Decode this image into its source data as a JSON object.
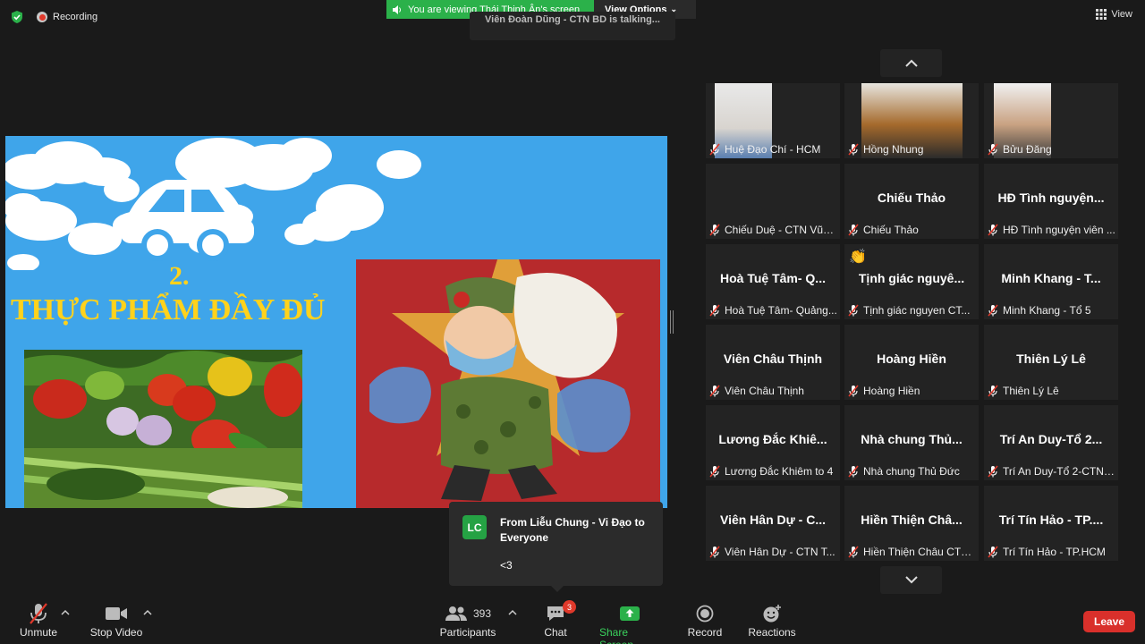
{
  "topbar": {
    "recording_label": "Recording",
    "viewing_banner": "You are viewing Thái Thịnh Ân's screen",
    "view_options_label": "View Options",
    "talking_indicator": "Viên Đoàn Dũng - CTN BD is talking...",
    "view_label": "View"
  },
  "slide": {
    "number": "2.",
    "title": "THỰC PHẨM ĐẦY ĐỦ"
  },
  "gallery": {
    "tiles": [
      {
        "display": "",
        "footer": "Huệ Đạo Chí - HCM"
      },
      {
        "display": "",
        "footer": "Hồng Nhung"
      },
      {
        "display": "",
        "footer": "Bửu Đăng"
      },
      {
        "display": "",
        "footer": "Chiếu Duệ - CTN Vũn..."
      },
      {
        "display": "Chiếu Thảo",
        "footer": "Chiếu Thảo"
      },
      {
        "display": "HĐ Tình nguyện...",
        "footer": "HĐ Tình nguyện viên ..."
      },
      {
        "display": "Hoà Tuệ Tâm- Q...",
        "footer": "Hoà Tuệ Tâm- Quảng..."
      },
      {
        "display": "Tịnh giác nguyê...",
        "footer": "Tịnh giác nguyen CT..."
      },
      {
        "display": "Minh Khang - T...",
        "footer": "Minh Khang - Tổ 5"
      },
      {
        "display": "Viên Châu Thịnh",
        "footer": "Viên Châu Thịnh"
      },
      {
        "display": "Hoàng Hiền",
        "footer": "Hoàng Hiền"
      },
      {
        "display": "Thiên Lý Lê",
        "footer": "Thiên Lý Lê"
      },
      {
        "display": "Lương Đắc Khiê...",
        "footer": "Lương Đắc Khiêm to 4"
      },
      {
        "display": "Nhà chung Thủ...",
        "footer": "Nhà chung Thủ Đức"
      },
      {
        "display": "Trí An Duy-Tổ 2...",
        "footer": "Trí An Duy-Tổ 2-CTN ..."
      },
      {
        "display": "Viên Hân Dự - C...",
        "footer": "Viên Hân Dự - CTN T..."
      },
      {
        "display": "Hiền Thiện Châ...",
        "footer": "Hiền Thiện Châu CTN..."
      },
      {
        "display": "Trí Tín Hảo - TP....",
        "footer": "Trí Tín Hảo - TP.HCM"
      }
    ]
  },
  "chat_popup": {
    "avatar_initials": "LC",
    "from": "From Liễu Chung -  Vi Đạo to Everyone",
    "message": "<3"
  },
  "toolbar": {
    "unmute_label": "Unmute",
    "stop_video_label": "Stop Video",
    "participants_count": "393",
    "participants_label": "Participants",
    "chat_label": "Chat",
    "chat_badge": "3",
    "share_label": "Share Screen",
    "record_label": "Record",
    "reactions_label": "Reactions",
    "leave_label": "Leave"
  },
  "colors": {
    "accent_green": "#2bb14a",
    "leave_red": "#d9302b",
    "slide_blue": "#3fa5ea",
    "slide_yellow": "#ffd21c"
  }
}
